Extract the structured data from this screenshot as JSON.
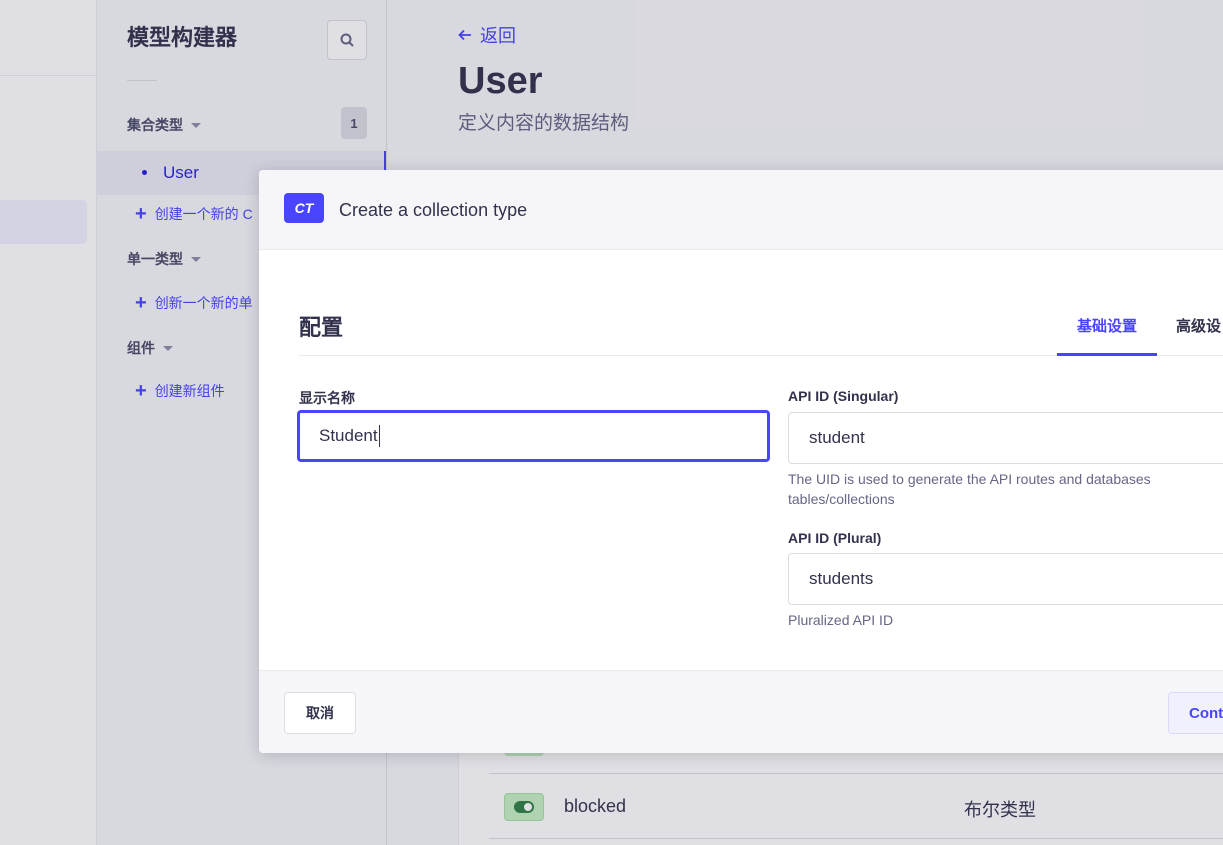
{
  "subnav": {
    "title": "模型构建器",
    "sections": [
      {
        "label": "集合类型",
        "count": "1",
        "items": [
          "User"
        ],
        "add_label": "创建一个新的 C"
      },
      {
        "label": "单一类型",
        "add_label": "创新一个新的单"
      },
      {
        "label": "组件",
        "add_label": "创建新组件"
      }
    ]
  },
  "main": {
    "back_label": "返回",
    "title": "User",
    "subtitle": "定义内容的数据结构",
    "field_row": {
      "name": "blocked",
      "type": "布尔类型"
    }
  },
  "modal": {
    "badge": "CT",
    "title": "Create a collection type",
    "section_title": "配置",
    "tabs": [
      "基础设置",
      "高级设"
    ],
    "display_name": {
      "label": "显示名称",
      "value": "Student"
    },
    "api_singular": {
      "label": "API ID (Singular)",
      "value": "student",
      "hint": "The UID is used to generate the API routes and databases tables/collections"
    },
    "api_plural": {
      "label": "API ID (Plural)",
      "value": "students",
      "hint": "Pluralized API ID"
    },
    "cancel_label": "取消",
    "continue_label": "Conti"
  },
  "colors": {
    "primary": "#4945ff",
    "primary_light": "#f0f0ff",
    "success_bg": "#c6f0c2"
  }
}
